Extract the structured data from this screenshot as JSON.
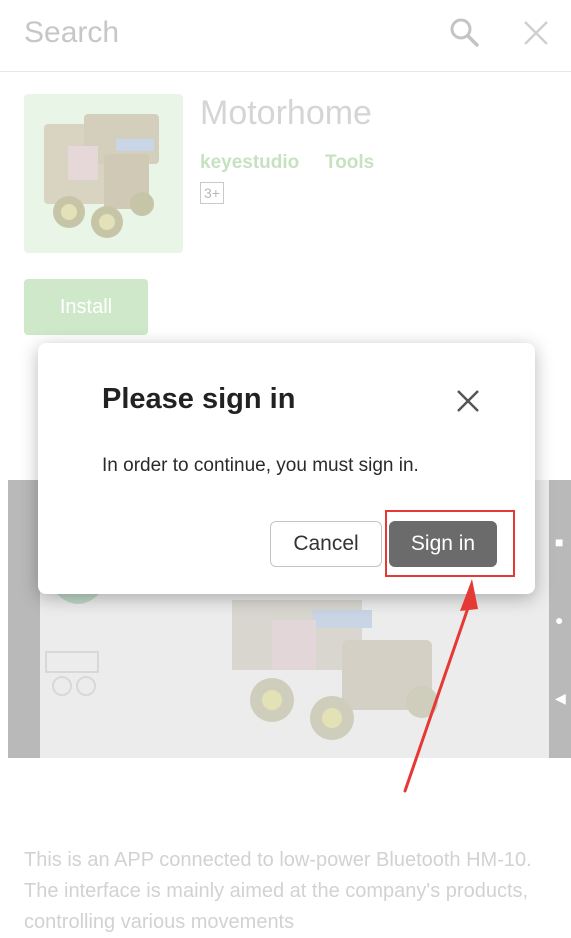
{
  "search": {
    "placeholder": "Search"
  },
  "app": {
    "title": "Motorhome",
    "developer": "keyestudio",
    "category": "Tools",
    "rating": "3+",
    "install_label": "Install",
    "description": "This is an APP connected to low-power Bluetooth HM-10. The interface is mainly aimed at the company's products, controlling various movements"
  },
  "dialog": {
    "title": "Please sign in",
    "message": "In order to continue, you must sign in.",
    "cancel_label": "Cancel",
    "signin_label": "Sign in"
  },
  "colors": {
    "accent": "#e53935",
    "signin_button": "#6b6b6b",
    "brand_green": "#c6e2c0"
  },
  "icons": [
    "search-icon",
    "close-icon",
    "dialog-close-icon"
  ]
}
